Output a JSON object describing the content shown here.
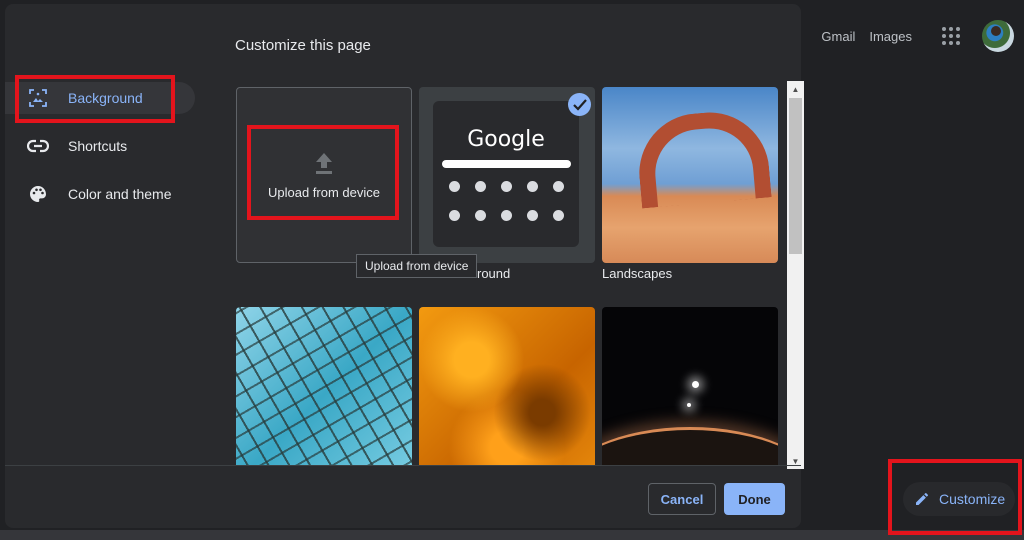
{
  "header": {
    "links": [
      "Gmail",
      "Images"
    ],
    "apps_icon": "apps-grid-icon",
    "avatar": "user-avatar"
  },
  "dialog": {
    "title": "Customize this page",
    "sidebar": [
      {
        "label": "Background",
        "icon": "image-icon",
        "active": true
      },
      {
        "label": "Shortcuts",
        "icon": "link-icon",
        "active": false
      },
      {
        "label": "Color and theme",
        "icon": "palette-icon",
        "active": false
      }
    ],
    "tiles": [
      {
        "label": "Upload from device",
        "type": "upload"
      },
      {
        "label": "No background",
        "visible_label": "round",
        "type": "default",
        "selected": true
      },
      {
        "label": "Landscapes",
        "type": "collection"
      },
      {
        "label": "",
        "type": "collection"
      },
      {
        "label": "",
        "type": "collection"
      },
      {
        "label": "",
        "type": "collection"
      }
    ],
    "tooltip": "Upload from device",
    "preview": {
      "logo_text": "Google"
    },
    "buttons": {
      "cancel": "Cancel",
      "done": "Done"
    }
  },
  "customize_button": {
    "label": "Customize",
    "icon": "pencil-icon"
  },
  "colors": {
    "accent": "#8ab4f8",
    "highlight": "#e3141c",
    "dialog_bg": "#292a2d",
    "page_bg": "#202124"
  }
}
